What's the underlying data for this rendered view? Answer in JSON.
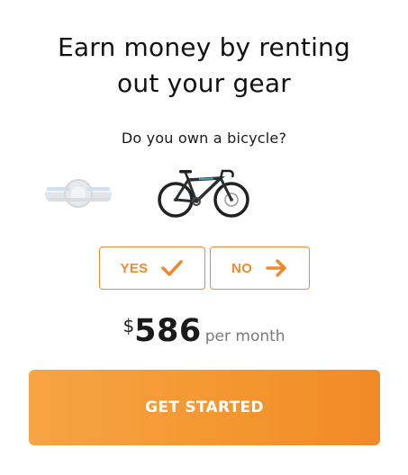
{
  "headline": {
    "line1": "Earn money by renting",
    "line2": "out your gear"
  },
  "question": "Do you own a bicycle?",
  "gear": {
    "items": [
      {
        "icon": "onewheel-board-icon",
        "state": "faded"
      },
      {
        "icon": "bicycle-icon",
        "state": "active"
      }
    ]
  },
  "answers": {
    "yes_label": "YES",
    "yes_icon": "checkmark-icon",
    "no_label": "NO",
    "no_icon": "arrow-right-icon"
  },
  "earnings": {
    "currency": "$",
    "amount": "586",
    "period": "per month"
  },
  "cta": {
    "label": "GET STARTED"
  },
  "colors": {
    "accent": "#ef8a2d",
    "cta_gradient_start": "#f6a444",
    "cta_gradient_end": "#f18a26",
    "text": "#1a1a1a",
    "muted": "#7a7a7a"
  }
}
